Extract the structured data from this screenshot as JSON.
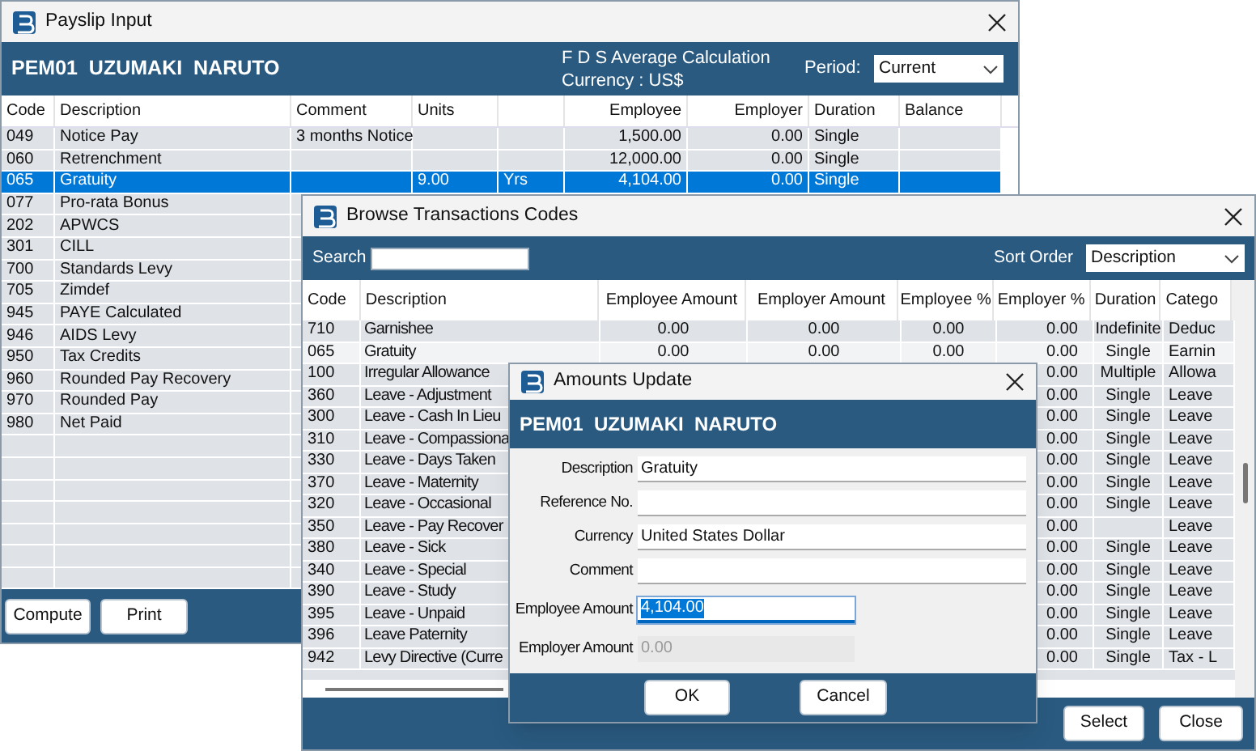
{
  "payslip_window": {
    "title": "Payslip Input",
    "employee": "PEM01  UZUMAKI  NARUTO",
    "calculation": "F D S Average Calculation",
    "currency": "Currency : US$",
    "period_label": "Period:",
    "period": "Current",
    "columns": [
      "Code",
      "Description",
      "Comment",
      "Units",
      "Employee",
      "Employer",
      "Duration",
      "Balance"
    ],
    "rows": [
      {
        "code": "049",
        "description": "Notice Pay",
        "comment": "3 months Notice",
        "employee": "1,500.00",
        "employer": "0.00",
        "duration": "Single",
        "selected": false
      },
      {
        "code": "060",
        "description": "Retrenchment",
        "employee": "12,000.00",
        "employer": "0.00",
        "duration": "Single",
        "selected": false
      },
      {
        "code": "065",
        "description": "Gratuity",
        "units": "9.00",
        "unit": "Yrs",
        "employee": "4,104.00",
        "employer": "0.00",
        "duration": "Single",
        "selected": true
      },
      {
        "code": "077",
        "description": "Pro-rata Bonus",
        "selected": false
      },
      {
        "code": "202",
        "description": "APWCS",
        "selected": false
      },
      {
        "code": "301",
        "description": "CILL",
        "selected": false
      },
      {
        "code": "700",
        "description": "Standards Levy",
        "selected": false
      },
      {
        "code": "705",
        "description": "Zimdef",
        "selected": false
      },
      {
        "code": "945",
        "description": "PAYE Calculated",
        "selected": false
      },
      {
        "code": "946",
        "description": "AIDS Levy",
        "selected": false
      },
      {
        "code": "950",
        "description": "Tax Credits",
        "selected": false
      },
      {
        "code": "960",
        "description": "Rounded Pay Recovery",
        "selected": false
      },
      {
        "code": "970",
        "description": "Rounded Pay",
        "selected": false
      },
      {
        "code": "980",
        "description": "Net Paid",
        "selected": false
      }
    ],
    "buttons": [
      "Compute",
      "Print"
    ]
  },
  "browse_window": {
    "title": "Browse Transactions Codes",
    "search_label": "Search",
    "sort_label": "Sort Order",
    "sort_value": "Description",
    "columns": [
      "Code",
      "Description",
      "Employee Amount",
      "Employer Amount",
      "Employee %",
      "Employer %",
      "Duration",
      "Catego"
    ],
    "rows": [
      {
        "code": "710",
        "description": "Garnishee",
        "employee_amount": "0.00",
        "employer_amount": "0.00",
        "employee_pct": "0.00",
        "employer_pct": "0.00",
        "duration": "Indefinite",
        "category": "Deduc",
        "selected": false
      },
      {
        "code": "065",
        "description": "Gratuity",
        "employee_amount": "0.00",
        "employer_amount": "0.00",
        "employee_pct": "0.00",
        "employer_pct": "0.00",
        "duration": "Single",
        "category": "Earnin",
        "selected": true
      },
      {
        "code": "100",
        "description": "Irregular Allowance",
        "employer_pct": "0.00",
        "duration": "Multiple",
        "category": "Allowa",
        "selected": false
      },
      {
        "code": "360",
        "description": "Leave - Adjustment",
        "employer_pct": "0.00",
        "duration": "Single",
        "category": "Leave",
        "selected": false
      },
      {
        "code": "300",
        "description": "Leave - Cash In Lieu",
        "employer_pct": "0.00",
        "duration": "Single",
        "category": "Leave",
        "selected": false
      },
      {
        "code": "310",
        "description": "Leave - Compassiona",
        "employer_pct": "0.00",
        "duration": "Single",
        "category": "Leave",
        "selected": false
      },
      {
        "code": "330",
        "description": "Leave - Days Taken",
        "employer_pct": "0.00",
        "duration": "Single",
        "category": "Leave",
        "selected": false
      },
      {
        "code": "370",
        "description": "Leave - Maternity",
        "employer_pct": "0.00",
        "duration": "Single",
        "category": "Leave",
        "selected": false
      },
      {
        "code": "320",
        "description": "Leave - Occasional",
        "employer_pct": "0.00",
        "duration": "Single",
        "category": "Leave",
        "selected": false
      },
      {
        "code": "350",
        "description": "Leave - Pay Recover",
        "employer_pct": "0.00",
        "category": "Leave",
        "selected": false
      },
      {
        "code": "380",
        "description": "Leave - Sick",
        "employer_pct": "0.00",
        "duration": "Single",
        "category": "Leave",
        "selected": false
      },
      {
        "code": "340",
        "description": "Leave - Special",
        "employer_pct": "0.00",
        "duration": "Single",
        "category": "Leave",
        "selected": false
      },
      {
        "code": "390",
        "description": "Leave - Study",
        "employer_pct": "0.00",
        "duration": "Single",
        "category": "Leave",
        "selected": false
      },
      {
        "code": "395",
        "description": "Leave - Unpaid",
        "employer_pct": "0.00",
        "duration": "Single",
        "category": "Leave",
        "selected": false
      },
      {
        "code": "396",
        "description": "Leave Paternity",
        "employer_pct": "0.00",
        "duration": "Single",
        "category": "Leave",
        "selected": false
      },
      {
        "code": "942",
        "description": "Levy Directive (Curre",
        "employer_pct": "0.00",
        "duration": "Single",
        "category": "Tax - L",
        "selected": false
      }
    ],
    "buttons": [
      "Select",
      "Close"
    ]
  },
  "amounts_dialog": {
    "title": "Amounts Update",
    "employee": "PEM01  UZUMAKI  NARUTO",
    "fields": [
      {
        "label": "Description",
        "value": "Gratuity",
        "kind": "text",
        "disabled": false,
        "highlighted": false
      },
      {
        "label": "Reference No.",
        "kind": "text",
        "disabled": false,
        "highlighted": false
      },
      {
        "label": "Currency",
        "value": "United States Dollar",
        "kind": "text",
        "disabled": false,
        "highlighted": false
      },
      {
        "label": "Comment",
        "kind": "text",
        "disabled": false,
        "highlighted": false
      },
      {
        "label": "Employee Amount",
        "value": "4,104.00",
        "kind": "amount",
        "disabled": false,
        "highlighted": true
      },
      {
        "label": "Employer Amount",
        "value": "0.00",
        "kind": "amount",
        "disabled": true,
        "highlighted": false
      }
    ],
    "buttons": [
      "OK",
      "Cancel"
    ]
  }
}
